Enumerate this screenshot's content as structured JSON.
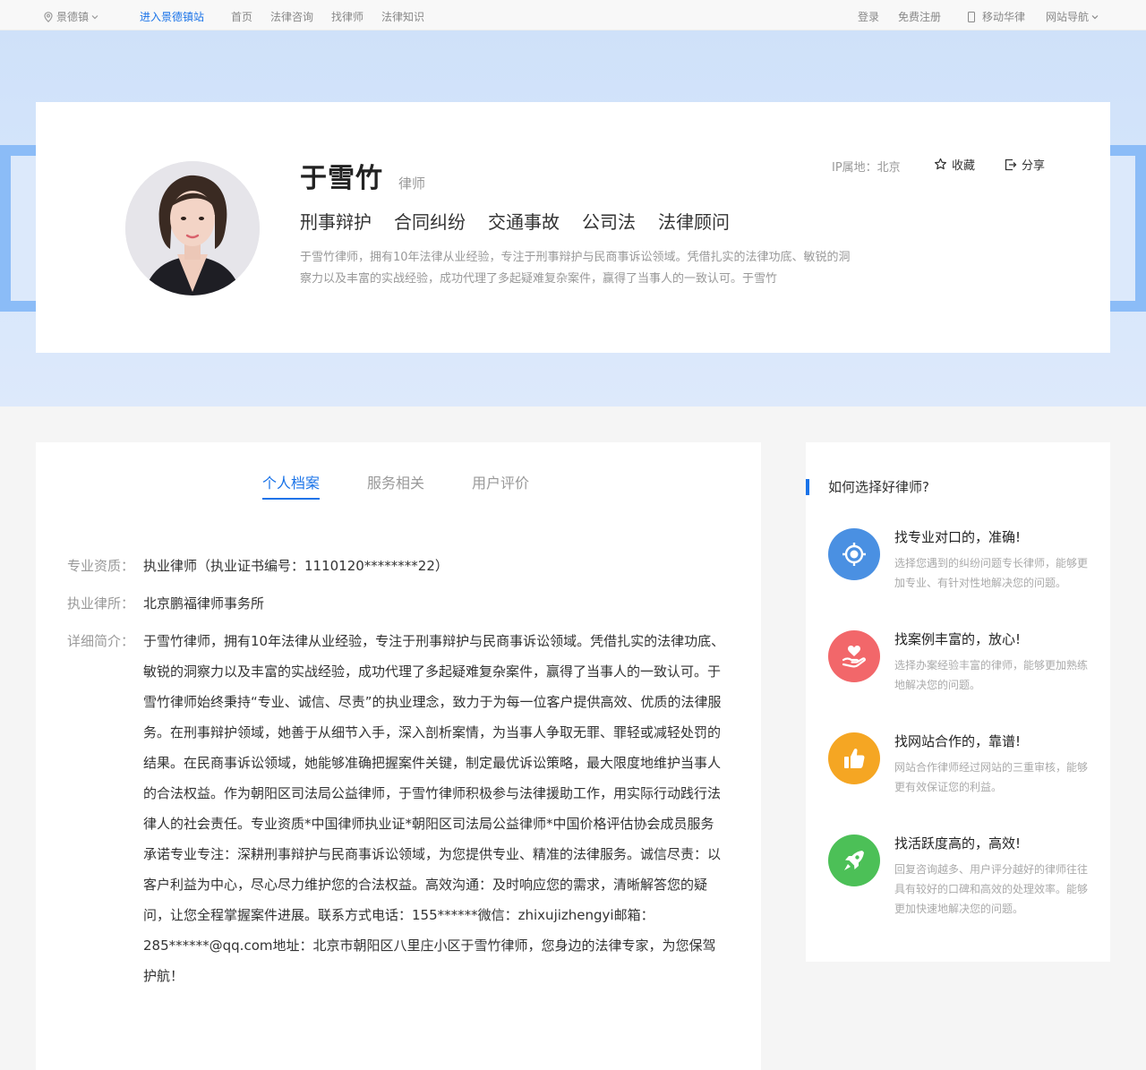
{
  "topbar": {
    "location": "景德镇",
    "enter_site": "进入景德镇站",
    "nav": [
      "首页",
      "法律咨询",
      "找律师",
      "法律知识"
    ],
    "login": "登录",
    "register": "免费注册",
    "mobile": "移动华律",
    "site_nav": "网站导航"
  },
  "profile": {
    "name": "于雪竹",
    "role": "律师",
    "specialties": [
      "刑事辩护",
      "合同纠纷",
      "交通事故",
      "公司法",
      "法律顾问"
    ],
    "summary": "于雪竹律师，拥有10年法律从业经验，专注于刑事辩护与民商事诉讼领域。凭借扎实的法律功底、敏锐的洞察力以及丰富的实战经验，成功代理了多起疑难复杂案件，赢得了当事人的一致认可。于雪竹",
    "ip_location": "IP属地：北京",
    "favorite": "收藏",
    "share": "分享"
  },
  "tabs": [
    "个人档案",
    "服务相关",
    "用户评价"
  ],
  "details": {
    "qualification_label": "专业资质：",
    "qualification": "执业律师（执业证书编号：1110120********22）",
    "firm_label": "执业律所：",
    "firm": "北京鹏福律师事务所",
    "bio_label": "详细简介：",
    "bio": "于雪竹律师，拥有10年法律从业经验，专注于刑事辩护与民商事诉讼领域。凭借扎实的法律功底、敏锐的洞察力以及丰富的实战经验，成功代理了多起疑难复杂案件，赢得了当事人的一致认可。于雪竹律师始终秉持“专业、诚信、尽责”的执业理念，致力于为每一位客户提供高效、优质的法律服务。在刑事辩护领域，她善于从细节入手，深入剖析案情，为当事人争取无罪、罪轻或减轻处罚的结果。在民商事诉讼领域，她能够准确把握案件关键，制定最优诉讼策略，最大限度地维护当事人的合法权益。作为朝阳区司法局公益律师，于雪竹律师积极参与法律援助工作，用实际行动践行法律人的社会责任。专业资质*中国律师执业证*朝阳区司法局公益律师*中国价格评估协会成员服务承诺专业专注：深耕刑事辩护与民商事诉讼领域，为您提供专业、精准的法律服务。诚信尽责：以客户利益为中心，尽心尽力维护您的合法权益。高效沟通：及时响应您的需求，清晰解答您的疑问，让您全程掌握案件进展。联系方式电话：155******微信：zhixujizhengyi邮箱：285******@qq.com地址：北京市朝阳区八里庄小区于雪竹律师，您身边的法律专家，为您保驾护航！"
  },
  "sidebar": {
    "title": "如何选择好律师?",
    "tips": [
      {
        "title": "找专业对口的，准确!",
        "desc": "选择您遇到的纠纷问题专长律师，能够更加专业、有针对性地解决您的问题。",
        "icon": "target-icon",
        "color": "#4a90e2"
      },
      {
        "title": "找案例丰富的，放心!",
        "desc": "选择办案经验丰富的律师，能够更加熟练地解决您的问题。",
        "icon": "heart-hand-icon",
        "color": "#f2676a"
      },
      {
        "title": "找网站合作的，靠谱!",
        "desc": "网站合作律师经过网站的三重审核，能够更有效保证您的利益。",
        "icon": "thumbs-up-icon",
        "color": "#f5a623"
      },
      {
        "title": "找活跃度高的，高效!",
        "desc": "回复咨询越多、用户评分越好的律师往往具有较好的口碑和高效的处理效率。能够更加快速地解决您的问题。",
        "icon": "rocket-icon",
        "color": "#4cc057"
      }
    ]
  }
}
